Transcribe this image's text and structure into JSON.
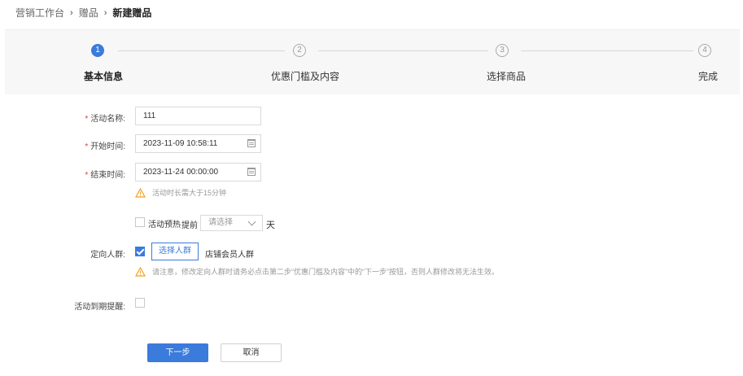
{
  "breadcrumb": {
    "items": [
      "营销工作台",
      "赠品",
      "新建赠品"
    ],
    "separator": "›"
  },
  "steps": [
    {
      "number": "1",
      "label": "基本信息",
      "state": "active"
    },
    {
      "number": "2",
      "label": "优惠门槛及内容",
      "state": "idle"
    },
    {
      "number": "3",
      "label": "选择商品",
      "state": "idle"
    },
    {
      "number": "4",
      "label": "完成",
      "state": "idle"
    }
  ],
  "form": {
    "activity_name": {
      "label": "活动名称:",
      "required": true,
      "value": "111"
    },
    "start_time": {
      "label": "开始时间:",
      "required": true,
      "value": "2023-11-09 10:58:11"
    },
    "end_time": {
      "label": "结束时间:",
      "required": true,
      "value": "2023-11-24 00:00:00"
    },
    "duration_hint": "活动时长需大于15分钟",
    "preheat": {
      "checkbox_label": "活动预热",
      "advance_label": "提前",
      "select_placeholder": "请选择",
      "unit": "天",
      "checked": false
    },
    "target_audience": {
      "label": "定向人群:",
      "checked": true,
      "button_label": "选择人群",
      "selected_text": "店铺会员人群"
    },
    "audience_hint": "请注意，修改定向人群时请务必点击第二步“优惠门槛及内容”中的“下一步”按钮，否则人群修改将无法生效。",
    "expiry_reminder": {
      "label": "活动到期提醒:",
      "checked": false
    }
  },
  "actions": {
    "next_label": "下一步",
    "cancel_label": "取消"
  },
  "colors": {
    "primary": "#3a7bdc",
    "required": "#e4393c",
    "warning": "#f0a020"
  }
}
